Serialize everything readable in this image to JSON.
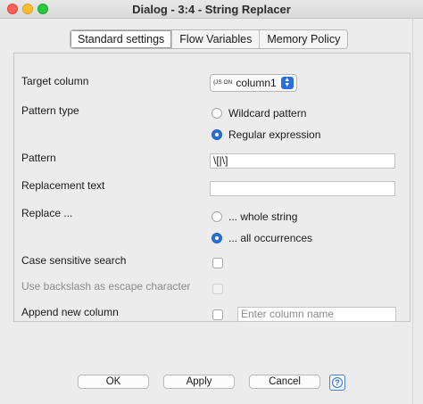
{
  "window": {
    "title": "Dialog - 3:4 - String Replacer"
  },
  "tabs": [
    {
      "label": "Standard settings",
      "active": true
    },
    {
      "label": "Flow Variables",
      "active": false
    },
    {
      "label": "Memory Policy",
      "active": false
    }
  ],
  "form": {
    "target_column_label": "Target column",
    "target_column_icon": "json-icon",
    "target_column_icon_text": "{JS ON",
    "target_column_value": "column1",
    "pattern_type_label": "Pattern type",
    "pattern_type_options": [
      {
        "label": "Wildcard pattern",
        "selected": false
      },
      {
        "label": "Regular expression",
        "selected": true
      }
    ],
    "pattern_label": "Pattern",
    "pattern_value": "\\[|\\]",
    "replacement_label": "Replacement text",
    "replacement_value": "",
    "replace_label": "Replace ...",
    "replace_options": [
      {
        "label": "... whole string",
        "selected": false
      },
      {
        "label": "... all occurrences",
        "selected": true
      }
    ],
    "case_sensitive_label": "Case sensitive search",
    "case_sensitive_checked": false,
    "backslash_label": "Use backslash as escape character",
    "backslash_checked": false,
    "append_label": "Append new column",
    "append_checked": false,
    "column_name_placeholder": "Enter column name"
  },
  "buttons": {
    "ok": "OK",
    "apply": "Apply",
    "cancel": "Cancel",
    "help_icon": "?"
  },
  "colors": {
    "accent": "#2a6fdb",
    "close": "#fe5f57",
    "minimize": "#febc2e",
    "zoom": "#28c840"
  }
}
